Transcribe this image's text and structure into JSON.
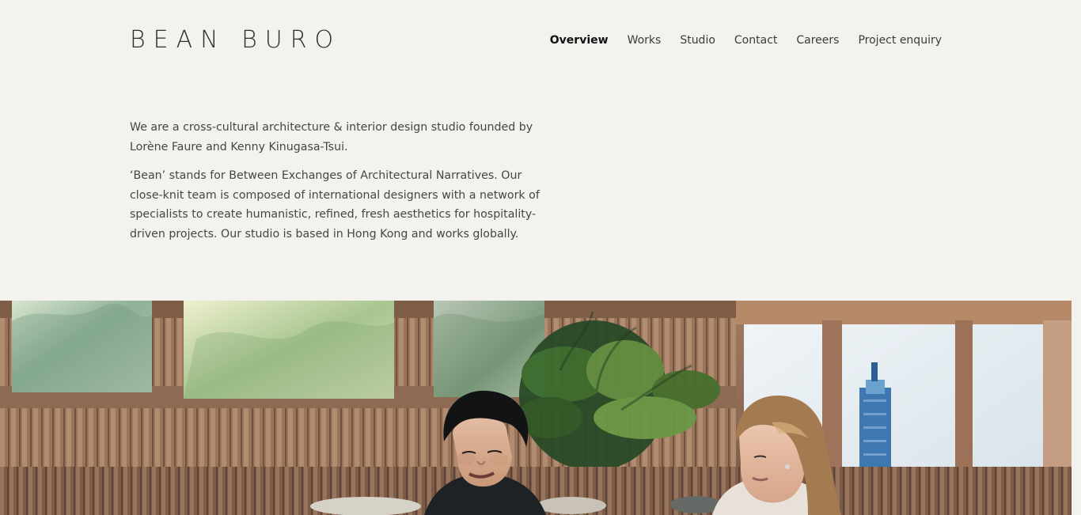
{
  "brand": {
    "name": "BEAN BURO"
  },
  "nav": {
    "items": [
      {
        "label": "Overview",
        "active": true
      },
      {
        "label": "Works",
        "active": false
      },
      {
        "label": "Studio",
        "active": false
      },
      {
        "label": "Contact",
        "active": false
      },
      {
        "label": "Careers",
        "active": false
      },
      {
        "label": "Project enquiry",
        "active": false
      }
    ]
  },
  "intro": {
    "paragraphs": [
      "We are a cross-cultural architecture & interior design studio founded by Lorène Faure and Kenny Kinugasa-Tsui.",
      "‘Bean’ stands for Between Exchanges of Architectural Narratives. Our close-knit team is composed of international designers with a network of specialists to create humanistic, refined, fresh aesthetics for hospitality-driven projects. Our studio is based in Hong Kong and works globally."
    ]
  },
  "colors": {
    "background": "#f3f2ef",
    "text": "#454545",
    "nav_active": "#111111"
  }
}
